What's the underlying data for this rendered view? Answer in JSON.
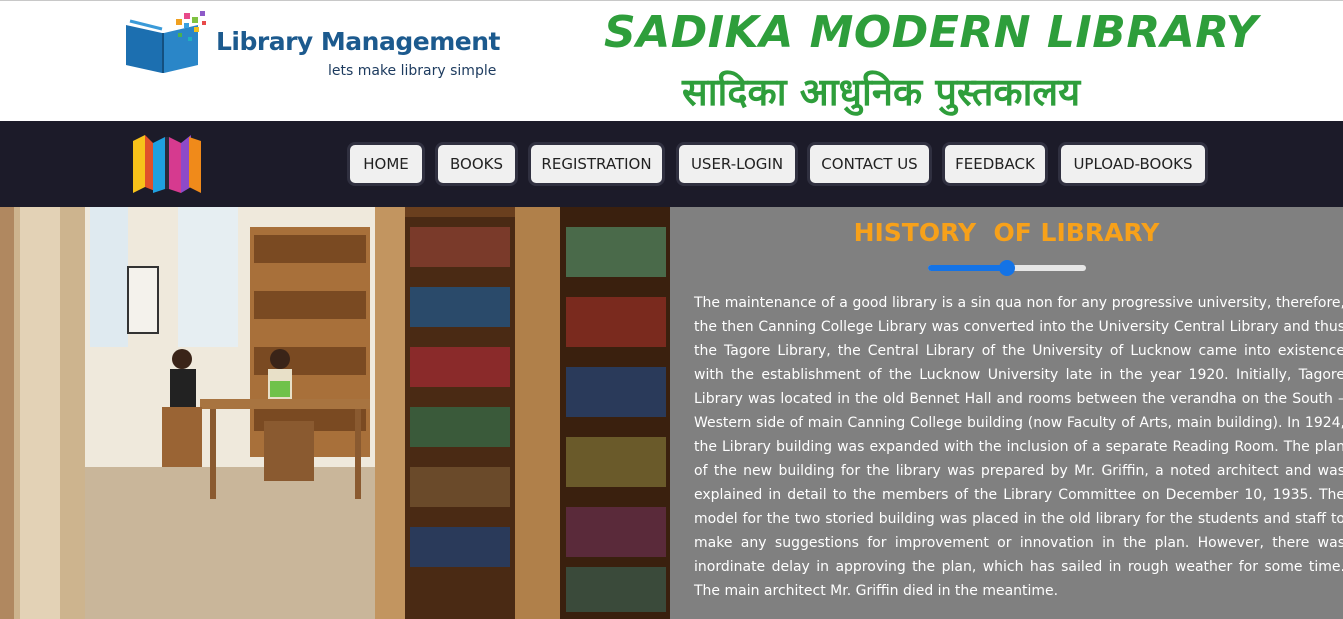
{
  "header": {
    "logo_title": "Library Management",
    "logo_tagline": "lets make library simple",
    "site_title": "SADIKA MODERN LIBRARY",
    "site_subtitle": "सादिका आधुनिक पुस्तकालय"
  },
  "nav": {
    "logo_icon": "books-logo-icon",
    "items": [
      "HOME",
      "BOOKS",
      "REGISTRATION",
      "USER-LOGIN",
      "CONTACT US",
      "FEEDBACK",
      "UPLOAD-BOOKS"
    ]
  },
  "main": {
    "image_subject": "library-reading-room-photo",
    "history_title": "HISTORY  OF LIBRARY",
    "scroll_indicator": {
      "value": 0.5
    },
    "history_text": "The maintenance of a good library is a sin qua non for any progressive university, therefore, the then Canning College Library was converted into the University Central Library and thus the Tagore Library, the Central Library of the University of Lucknow came into existence with the establishment of the Lucknow University late in the year 1920. Initially, Tagore Library was located in the old Bennet Hall and rooms between the verandha on the South – Western side of main Canning College building (now Faculty of Arts, main building). In 1924, the Library building was expanded with the inclusion of a separate Reading Room. The plan of the new building for the library was prepared by Mr. Griffin, a noted architect and was explained in detail to the members of the Library Committee on December 10, 1935. The model for the two storied building was placed in the old library for the students and staff to make any suggestions for improvement or innovation in the plan. However, there was inordinate delay in approving the plan, which has sailed in rough weather for some time. The main architect Mr. Griffin died in the meantime."
  },
  "colors": {
    "title_green": "#2e9e3b",
    "navbar_bg": "#1c1b29",
    "history_bg": "#808080",
    "history_title": "#f7a11a",
    "slider_blue": "#1473e6",
    "logo_blue": "#1c5a8e"
  }
}
